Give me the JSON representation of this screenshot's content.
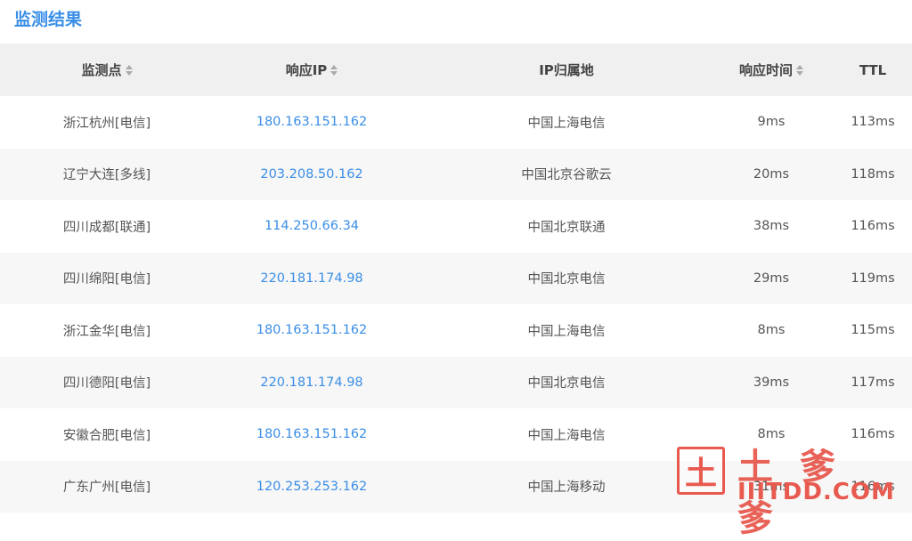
{
  "page_title": "监测结果",
  "columns": [
    "监测点",
    "响应IP",
    "IP归属地",
    "响应时间",
    "TTL"
  ],
  "rows": [
    {
      "node": "浙江杭州[电信]",
      "ip": "180.163.151.162",
      "location": "中国上海电信",
      "time": "9ms",
      "ttl": "113ms"
    },
    {
      "node": "辽宁大连[多线]",
      "ip": "203.208.50.162",
      "location": "中国北京谷歌云",
      "time": "20ms",
      "ttl": "118ms"
    },
    {
      "node": "四川成都[联通]",
      "ip": "114.250.66.34",
      "location": "中国北京联通",
      "time": "38ms",
      "ttl": "116ms"
    },
    {
      "node": "四川绵阳[电信]",
      "ip": "220.181.174.98",
      "location": "中国北京电信",
      "time": "29ms",
      "ttl": "119ms"
    },
    {
      "node": "浙江金华[电信]",
      "ip": "180.163.151.162",
      "location": "中国上海电信",
      "time": "8ms",
      "ttl": "115ms"
    },
    {
      "node": "四川德阳[电信]",
      "ip": "220.181.174.98",
      "location": "中国北京电信",
      "time": "39ms",
      "ttl": "117ms"
    },
    {
      "node": "安徽合肥[电信]",
      "ip": "180.163.151.162",
      "location": "中国上海电信",
      "time": "8ms",
      "ttl": "116ms"
    },
    {
      "node": "广东广州[电信]",
      "ip": "120.253.253.162",
      "location": "中国上海移动",
      "time": "31ms",
      "ttl": "116ms"
    }
  ],
  "watermark": {
    "box_char": "土",
    "chars": "土爹爹",
    "url": "IIITDD.COM"
  },
  "colors": {
    "title": "#3a8ee6",
    "ip": "#3a8ee6",
    "header_bg": "#f0f0f0",
    "alt_row_bg": "#f7f7f7",
    "watermark": "#e85a4f"
  }
}
